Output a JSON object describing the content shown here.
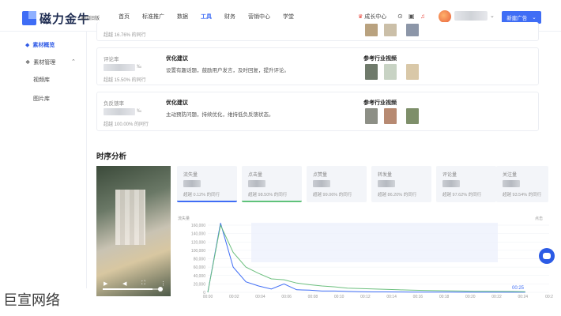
{
  "header": {
    "logo": "磁力金牛",
    "account": "返回旧版",
    "nav": [
      "首页",
      "标准推广",
      "数据",
      "工具",
      "财务",
      "营销中心",
      "学堂"
    ],
    "active_nav": "工具",
    "growth": "成长中心",
    "new_ad": "新建广告"
  },
  "sidebar": {
    "items": [
      {
        "label": "素材概览",
        "active": true
      },
      {
        "label": "素材管理",
        "active": false
      }
    ],
    "sub_items": [
      "视频库",
      "图片库"
    ]
  },
  "cards": [
    {
      "pct": "超越 16.76% 的同行",
      "thumbs": [
        "#b9a27f",
        "#cbbfa8",
        "#8c96a8"
      ]
    },
    {
      "metric": "评论率",
      "tail": "‰",
      "pct": "超越 15.50% 的同行",
      "advice_title": "优化建议",
      "advice": "设置有趣话题，鼓励用户发言，及时回复，提升评论。",
      "ref_title": "参考行业视频",
      "thumbs": [
        "#6f7a6b",
        "#c8d3c4",
        "#d9c8a8"
      ]
    },
    {
      "metric": "负反馈率",
      "tail": "‰",
      "pct": "超越 100.00% 的同行",
      "advice_title": "优化建议",
      "advice": "主动预防问题，持续优化，维持低负反馈状态。",
      "ref_title": "参考行业视频",
      "thumbs": [
        "#8d8f86",
        "#b78a72",
        "#7e8f6a"
      ]
    }
  ],
  "timing": {
    "title": "时序分析",
    "tiles": [
      {
        "name": "流失量",
        "pct": "超越 0.12% 的同行"
      },
      {
        "name": "点击量",
        "pct": "超越 98.50% 的同行"
      },
      {
        "name": "点赞量",
        "pct": "超越 99.06% 的同行"
      },
      {
        "name": "转发量",
        "pct": "超越 86.20% 的同行"
      },
      {
        "name": "评论量",
        "pct": "超越 97.62% 的同行"
      },
      {
        "name": "关注量",
        "pct": "超越 93.54% 的同行"
      }
    ],
    "duration": "00:25"
  },
  "chart_data": {
    "type": "line",
    "ylabel": "流失量",
    "y2label": "点击",
    "ylim": [
      0,
      160000
    ],
    "y_ticks": [
      "160,000",
      "140,000",
      "120,000",
      "100,000",
      "80,000",
      "60,000",
      "40,000",
      "20,000",
      "0"
    ],
    "x": [
      "00:00",
      "00:02",
      "00:04",
      "00:06",
      "00:08",
      "00:10",
      "00:12",
      "00:14",
      "00:16",
      "00:18",
      "00:20",
      "00:22",
      "00:24",
      "00:2"
    ],
    "series": [
      {
        "color": "#3f6df5",
        "values": [
          0,
          165000,
          60000,
          25000,
          15000,
          8000,
          20000,
          6000,
          5000,
          3000,
          3000,
          2000,
          1500,
          1000,
          1000,
          800,
          600,
          500,
          400,
          300,
          200,
          200,
          200,
          150,
          120,
          100
        ]
      },
      {
        "color": "#6cbf7e",
        "values": [
          0,
          160000,
          95000,
          60000,
          45000,
          32000,
          30000,
          22000,
          18000,
          15000,
          13000,
          10000,
          9000,
          8000,
          7000,
          6000,
          5000,
          4500,
          4000,
          3500,
          3000,
          2500,
          2200,
          2000,
          1800,
          1600
        ]
      }
    ],
    "grid": true
  }
}
